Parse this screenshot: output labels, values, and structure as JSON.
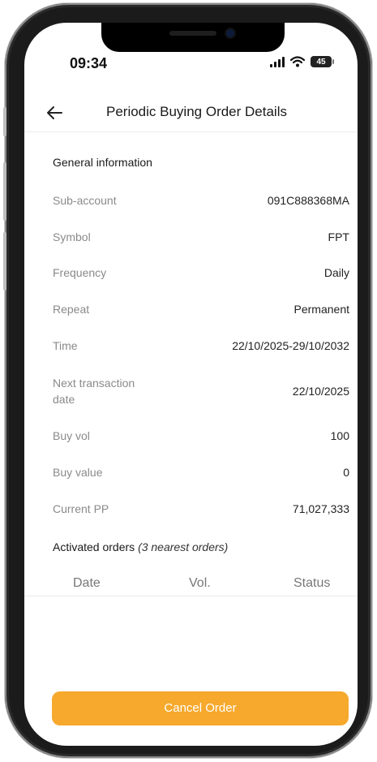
{
  "status_bar": {
    "time": "09:34",
    "battery": "45"
  },
  "header": {
    "title": "Periodic Buying Order Details"
  },
  "general": {
    "title": "General information",
    "rows": [
      {
        "label": "Sub-account",
        "value": "091C888368MA"
      },
      {
        "label": "Symbol",
        "value": "FPT"
      },
      {
        "label": "Frequency",
        "value": "Daily"
      },
      {
        "label": "Repeat",
        "value": "Permanent"
      },
      {
        "label": "Time",
        "value": "22/10/2025-29/10/2032"
      },
      {
        "label": "Next transaction date",
        "value": "22/10/2025"
      },
      {
        "label": "Buy vol",
        "value": "100"
      },
      {
        "label": "Buy value",
        "value": "0"
      },
      {
        "label": "Current PP",
        "value": "71,027,333"
      }
    ]
  },
  "activated": {
    "title": "Activated orders",
    "subtitle": "(3 nearest orders)",
    "columns": [
      "Date",
      "Vol.",
      "Status"
    ]
  },
  "actions": {
    "cancel_label": "Cancel Order",
    "accent": "#f6a92d"
  }
}
